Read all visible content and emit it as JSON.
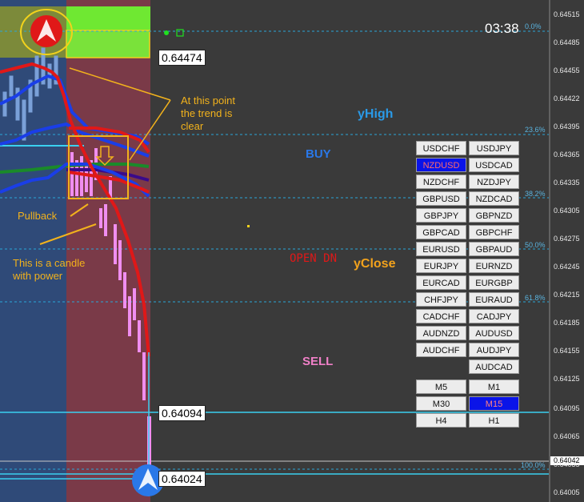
{
  "time": "03:38",
  "price_labels": {
    "top": "0.64474",
    "mid": "0.64094",
    "low": "0.64024",
    "current": "0.64042"
  },
  "axis_ticks": [
    "0.64515",
    "0.64485",
    "0.64455",
    "0.64422",
    "0.64395",
    "0.64365",
    "0.64335",
    "0.64305",
    "0.64275",
    "0.64245",
    "0.64215",
    "0.64185",
    "0.64155",
    "0.64125",
    "0.64095",
    "0.64065",
    "0.64035",
    "0.64005"
  ],
  "fib_levels": [
    "0.0%",
    "23.6%",
    "38.2%",
    "50.0%",
    "61.8%",
    "100.0%"
  ],
  "signals": {
    "yhigh": "yHigh",
    "buy": "BUY",
    "open": "OPEN  DN",
    "yclose": "yClose",
    "sell": "SELL"
  },
  "annotations": {
    "trend_line1": "At this point",
    "trend_line2": "the trend is",
    "trend_line3": "clear",
    "pullback": "Pullback",
    "power_line1": "This is a candle",
    "power_line2": "with power"
  },
  "symbols": [
    [
      "USDCHF",
      "USDJPY"
    ],
    [
      "NZDUSD",
      "USDCAD"
    ],
    [
      "NZDCHF",
      "NZDJPY"
    ],
    [
      "GBPUSD",
      "NZDCAD"
    ],
    [
      "GBPJPY",
      "GBPNZD"
    ],
    [
      "GBPCAD",
      "GBPCHF"
    ],
    [
      "EURUSD",
      "GBPAUD"
    ],
    [
      "EURJPY",
      "EURNZD"
    ],
    [
      "EURCAD",
      "EURGBP"
    ],
    [
      "CHFJPY",
      "EURAUD"
    ],
    [
      "CADCHF",
      "CADJPY"
    ],
    [
      "AUDNZD",
      "AUDUSD"
    ],
    [
      "AUDCHF",
      "AUDJPY"
    ],
    [
      "",
      "AUDCAD"
    ]
  ],
  "selected_symbol": "NZDUSD",
  "timeframes": [
    [
      "M5",
      "M1"
    ],
    [
      "M30",
      "M15"
    ],
    [
      "H4",
      "H1"
    ]
  ],
  "selected_timeframe": "M15",
  "colors": {
    "background": "#3a3a3a",
    "blue_zone": "#2f4a78",
    "red_zone": "#7a3a48",
    "green_zone": "#78e83a",
    "red_line": "#e01818",
    "blue_line": "#1a3ee8",
    "candle": "#f08ef0",
    "annotation": "#f2b21c"
  }
}
